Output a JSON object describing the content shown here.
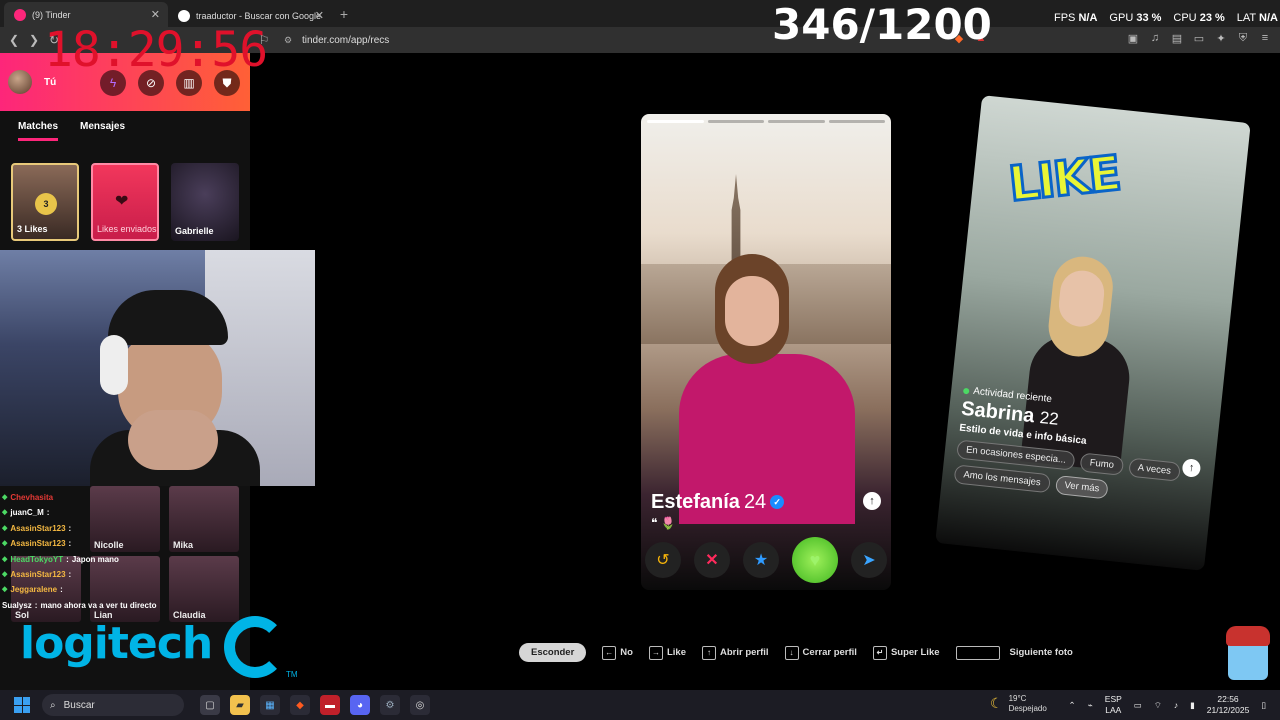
{
  "browser": {
    "tabs": [
      {
        "title": "(9) Tinder",
        "active": true,
        "favicon_color": "#fd267a"
      },
      {
        "title": "traaductor - Buscar con Google",
        "active": false,
        "favicon_color": "#ffffff"
      }
    ],
    "url": "tinder.com/app/recs"
  },
  "overlay": {
    "timer": "18:29:56",
    "counter": "346/1200",
    "fps_label": "FPS",
    "fps_value": "N/A",
    "gpu_label": "GPU",
    "gpu_value": "33 %",
    "cpu_label": "CPU",
    "cpu_value": "23 %",
    "lat_label": "LAT",
    "lat_value": "N/A"
  },
  "sidebar": {
    "user": "Tú",
    "tabs": [
      "Matches",
      "Mensajes"
    ],
    "likes_count": "3",
    "likes_label": "3 Likes",
    "sent_label": "Likes enviados",
    "match_name": "Gabrielle"
  },
  "lower_matches": [
    {
      "name": "Nicolle"
    },
    {
      "name": "Mika"
    },
    {
      "name": "Sol"
    },
    {
      "name": "Lian"
    },
    {
      "name": "Claudia"
    }
  ],
  "chat": [
    {
      "user": "Chevhasita",
      "msg": "",
      "color": "#e53935"
    },
    {
      "user": "juanC_M",
      "msg": "",
      "color": "#ffffff"
    },
    {
      "user": "AsasinStar123",
      "msg": "",
      "color": "#f5b942"
    },
    {
      "user": "AsasinStar123",
      "msg": "",
      "color": "#f5b942"
    },
    {
      "user": "HeadTokyoYT",
      "msg": "Japon mano",
      "color": "#4cd964"
    },
    {
      "user": "AsasinStar123",
      "msg": "",
      "color": "#f5b942"
    },
    {
      "user": "Jeggaralene",
      "msg": "",
      "color": "#f5b942"
    },
    {
      "user": "Sualysz",
      "msg": "mano ahora va a ver tu directo",
      "color": "#ffffff"
    }
  ],
  "sponsor": {
    "brand": "logitech",
    "tm": "TM",
    "color": "#00b4e6"
  },
  "profile": {
    "name": "Estefanía",
    "age": "24",
    "verified": true,
    "quote": "❝ 🌷",
    "photo_count": 4,
    "photo_index": 1
  },
  "side_profile": {
    "stamp": "LIKE",
    "activity": "Actividad reciente",
    "name": "Sabrina",
    "age": "22",
    "subtitle": "Estilo de vida e info básica",
    "chips": [
      "En ocasiones especia...",
      "Fumo",
      "A veces",
      "Amo los mensajes"
    ],
    "more": "Ver más"
  },
  "hints": {
    "hide": "Esconder",
    "no": "No",
    "like": "Like",
    "open": "Abrir perfil",
    "close": "Cerrar perfil",
    "super": "Super Like",
    "next": "Siguiente foto"
  },
  "taskbar": {
    "search": "Buscar",
    "temp": "19°C",
    "weather": "Despejado",
    "lang1": "ESP",
    "lang2": "LAA",
    "time": "22:56",
    "date": "21/12/2025"
  }
}
